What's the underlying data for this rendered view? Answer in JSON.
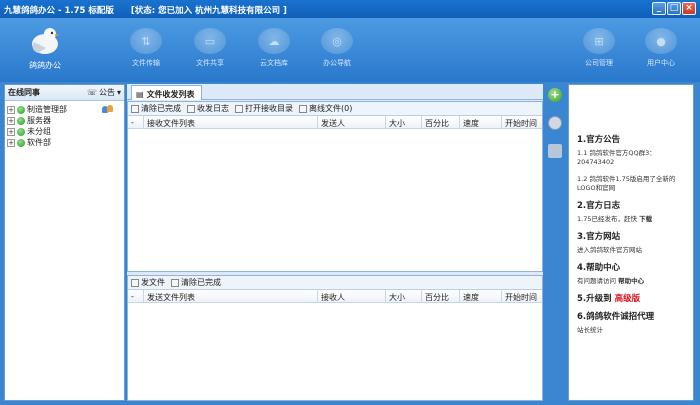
{
  "window": {
    "title": "九慧鸽鸽办公 - 1.75 标配版",
    "status": "[状态: 您已加入 杭州九慧科技有限公司 ]",
    "buttons": [
      "_",
      "□",
      "×"
    ]
  },
  "toolbar": {
    "brand": "鸽鸽办公",
    "items": [
      "文件传输",
      "文件共享",
      "云文档库",
      "办公导航"
    ],
    "right_items": [
      "公司管理",
      "用户中心"
    ]
  },
  "left": {
    "title": "在线同事",
    "announce": "公告",
    "tree": [
      "制造管理部",
      "服务器",
      "未分组",
      "软件部"
    ]
  },
  "center": {
    "tab": "文件收发列表",
    "top_actions": [
      "清除已完成",
      "收发日志",
      "打开接收目录",
      "离线文件(0)"
    ],
    "top_columns": [
      "-",
      "接收文件列表",
      "发送人",
      "大小",
      "百分比",
      "速度",
      "开始时间"
    ],
    "bottom_actions": [
      "发文件",
      "清除已完成"
    ],
    "bottom_columns": [
      "-",
      "发送文件列表",
      "接收人",
      "大小",
      "百分比",
      "速度",
      "开始时间"
    ]
  },
  "right": {
    "s1_title": "1.官方公告",
    "s1_p1": "1.1 鸽鸽软件官方QQ群3：204743402",
    "s1_p2": "1.2 鸽鸽软件1.75版启用了全新的LOGO和官网",
    "s2_title": "2.官方日志",
    "s2_text": "1.75已经发布，赶快",
    "s2_link": "下载",
    "s3_title": "3.官方网站",
    "s3_text": "进入鸽鸽软件官方网站",
    "s4_title": "4.帮助中心",
    "s4_text": "有问题请访问",
    "s4_link": "帮助中心",
    "s5_title": "5.升级到",
    "s5_highlight": "高级版",
    "s6_title": "6.鸽鸽软件诚招代理",
    "s6_text": "站长统计"
  }
}
